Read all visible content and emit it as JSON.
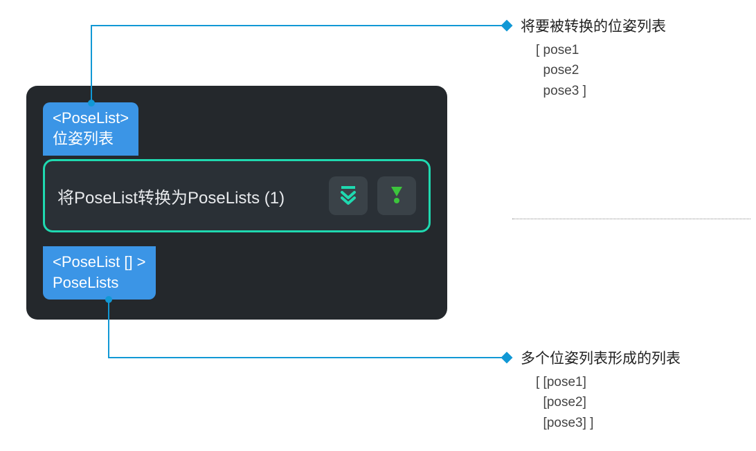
{
  "node": {
    "input_port": {
      "type_label": "<PoseList>",
      "name_label": "位姿列表"
    },
    "operation": {
      "title": "将PoseList转换为PoseLists (1)"
    },
    "output_port": {
      "type_label": "<PoseList [] >",
      "name_label": "PoseLists"
    }
  },
  "annotations": {
    "top": {
      "title": "将要被转换的位姿列表",
      "body": "[ pose1\n  pose2\n  pose3 ]"
    },
    "bottom": {
      "title": "多个位姿列表形成的列表",
      "body": "[ [pose1]\n  [pose2]\n  [pose3] ]"
    }
  }
}
